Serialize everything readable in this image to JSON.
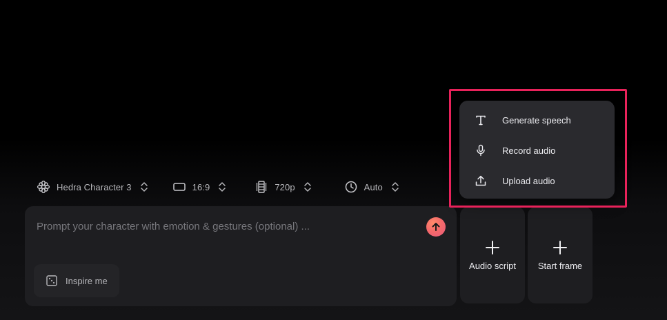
{
  "settings": {
    "model": "Hedra Character 3",
    "aspect_ratio": "16:9",
    "resolution": "720p",
    "duration": "Auto"
  },
  "prompt": {
    "placeholder": "Prompt your character with emotion & gestures (optional) ...",
    "value": "",
    "inspire_label": "Inspire me"
  },
  "cards": {
    "audio_script": "Audio script",
    "start_frame": "Start frame"
  },
  "audio_menu": {
    "items": [
      {
        "label": "Generate speech",
        "icon": "text-icon"
      },
      {
        "label": "Record audio",
        "icon": "microphone-icon"
      },
      {
        "label": "Upload audio",
        "icon": "upload-icon"
      }
    ]
  },
  "colors": {
    "background": "#000000",
    "panel": "#1e1e21",
    "menu": "#2a2a2e",
    "send_button": "#f56a6a",
    "highlight": "#e8225a"
  }
}
